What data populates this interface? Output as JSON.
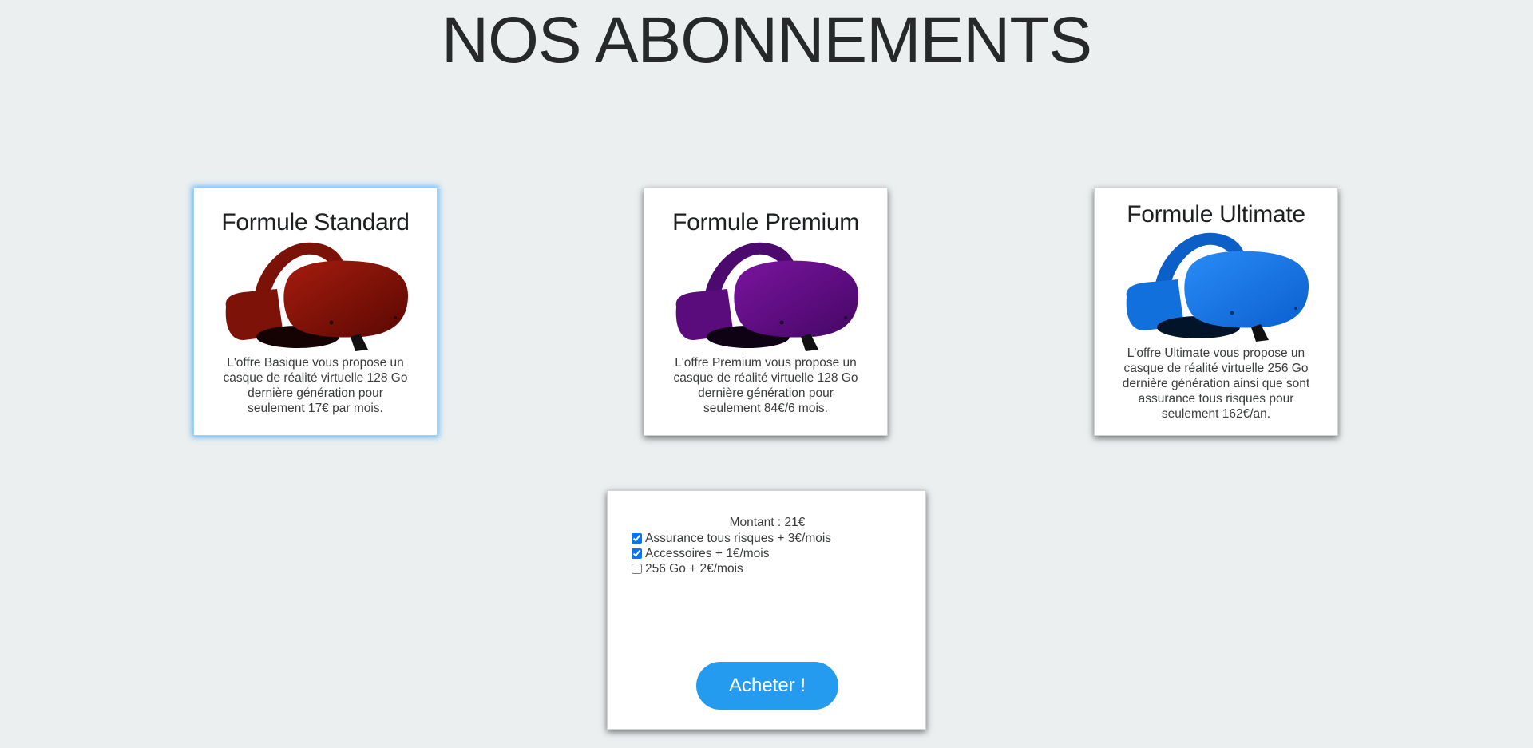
{
  "page": {
    "title": "NOS ABONNEMENTS"
  },
  "plans": [
    {
      "title": "Formule Standard",
      "description": "L'offre Basique vous propose un casque de réalité virtuelle 128 Go dernière génération pour seulement 17€ par mois.",
      "image_icon": "vr-headset-icon",
      "color": "#8b1206",
      "selected": true
    },
    {
      "title": "Formule Premium",
      "description": "L'offre Premium vous propose un casque de réalité virtuelle 128 Go dernière génération pour seulement 84€/6 mois.",
      "image_icon": "vr-headset-icon",
      "color": "#5f0a82",
      "selected": false
    },
    {
      "title": "Formule Ultimate",
      "description": "L'offre Ultimate vous propose un casque de réalité virtuelle 256 Go dernière génération ainsi que sont assurance tous risques pour seulement 162€/an.",
      "image_icon": "vr-headset-icon",
      "color": "#0f73e6",
      "selected": false
    }
  ],
  "purchase": {
    "amount_label": "Montant : 21€",
    "options": [
      {
        "label": "Assurance tous risques + 3€/mois",
        "checked": true
      },
      {
        "label": "Accessoires + 1€/mois",
        "checked": true
      },
      {
        "label": "256 Go + 2€/mois",
        "checked": false
      }
    ],
    "buy_label": "Acheter !"
  },
  "colors": {
    "background": "#ebeff0",
    "accent": "#249bef",
    "selected_glow": "#58aff5"
  }
}
